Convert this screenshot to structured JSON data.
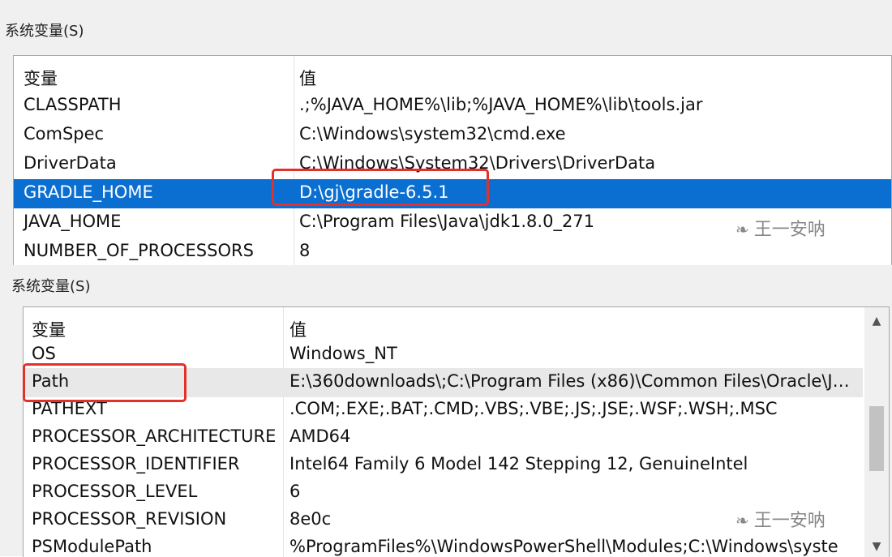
{
  "panel_top": {
    "group_label": "系统变量(S)",
    "header": {
      "name": "变量",
      "value": "值"
    },
    "rows": [
      {
        "name": "CLASSPATH",
        "value": ".;%JAVA_HOME%\\lib;%JAVA_HOME%\\lib\\tools.jar"
      },
      {
        "name": "ComSpec",
        "value": "C:\\Windows\\system32\\cmd.exe"
      },
      {
        "name": "DriverData",
        "value": "C:\\Windows\\System32\\Drivers\\DriverData"
      },
      {
        "name": "GRADLE_HOME",
        "value": "D:\\gj\\gradle-6.5.1"
      },
      {
        "name": "JAVA_HOME",
        "value": "C:\\Program Files\\Java\\jdk1.8.0_271"
      },
      {
        "name": "NUMBER_OF_PROCESSORS",
        "value": "8"
      }
    ],
    "selected_row": "GRADLE_HOME",
    "watermark": "王一安呐"
  },
  "panel_bottom": {
    "group_label": "系统变量(S)",
    "header": {
      "name": "变量",
      "value": "值"
    },
    "rows": [
      {
        "name": "OS",
        "value": "Windows_NT"
      },
      {
        "name": "Path",
        "value": "E:\\360downloads\\;C:\\Program Files (x86)\\Common Files\\Oracle\\Ja..."
      },
      {
        "name": "PATHEXT",
        "value": ".COM;.EXE;.BAT;.CMD;.VBS;.VBE;.JS;.JSE;.WSF;.WSH;.MSC"
      },
      {
        "name": "PROCESSOR_ARCHITECTURE",
        "value": "AMD64"
      },
      {
        "name": "PROCESSOR_IDENTIFIER",
        "value": "Intel64 Family 6 Model 142 Stepping 12, GenuineIntel"
      },
      {
        "name": "PROCESSOR_LEVEL",
        "value": "6"
      },
      {
        "name": "PROCESSOR_REVISION",
        "value": "8e0c"
      },
      {
        "name": "PSModulePath",
        "value": "%ProgramFiles%\\WindowsPowerShell\\Modules;C:\\Windows\\syste"
      }
    ],
    "highlighted_row": "Path",
    "watermark": "王一安呐"
  },
  "icons": {
    "watermark_icon": "wechat-icon",
    "scroll_up": "chevron-up-icon",
    "scroll_down": "chevron-down-icon"
  },
  "colors": {
    "selection": "#0a6fd1",
    "annotation_box": "#e0322a"
  }
}
